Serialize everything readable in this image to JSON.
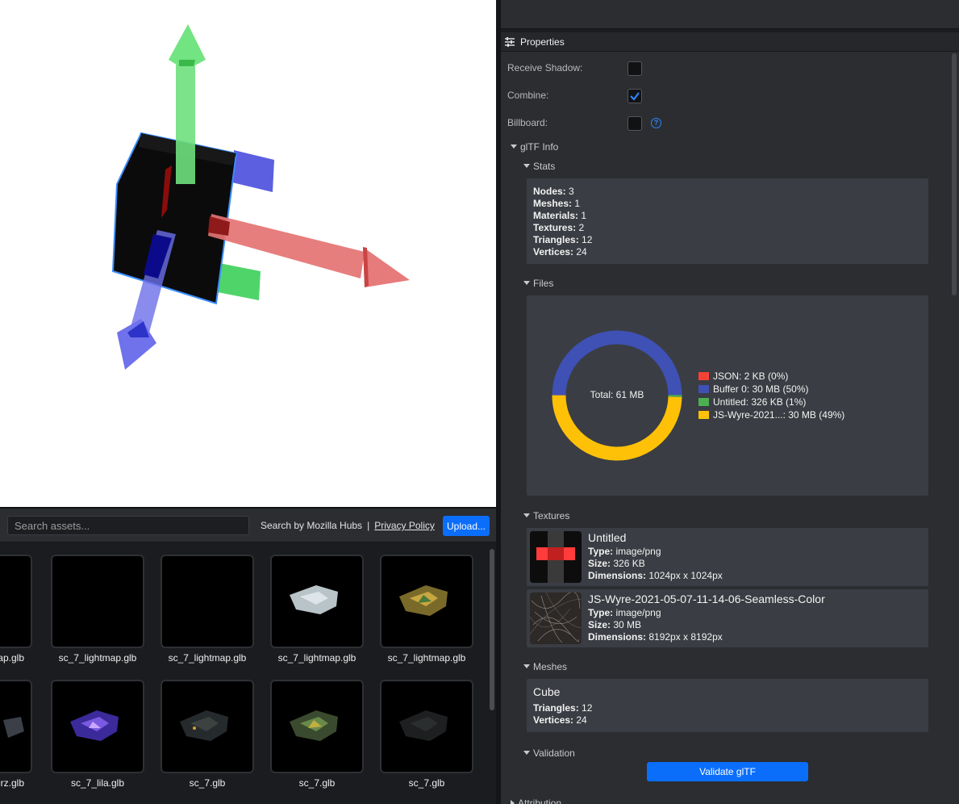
{
  "assets": {
    "search_placeholder": "Search assets...",
    "search_by_text": "Search by Mozilla Hubs",
    "separator": "|",
    "privacy_link": "Privacy Policy",
    "upload_label": "Upload...",
    "items": [
      {
        "label": "ap.glb"
      },
      {
        "label": "sc_7_lightmap.glb"
      },
      {
        "label": "sc_7_lightmap.glb"
      },
      {
        "label": "sc_7_lightmap.glb"
      },
      {
        "label": "sc_7_lightmap.glb"
      },
      {
        "label": "rz.glb"
      },
      {
        "label": "sc_7_lila.glb"
      },
      {
        "label": "sc_7.glb"
      },
      {
        "label": "sc_7.glb"
      },
      {
        "label": "sc_7.glb"
      }
    ]
  },
  "properties": {
    "title": "Properties",
    "receive_shadow_label": "Receive Shadow:",
    "receive_shadow_checked": false,
    "combine_label": "Combine:",
    "combine_checked": true,
    "billboard_label": "Billboard:",
    "billboard_checked": false,
    "help_glyph": "?",
    "gltf_info_label": "glTF Info",
    "stats_label": "Stats",
    "stats": [
      {
        "key": "Nodes:",
        "value": " 3"
      },
      {
        "key": "Meshes:",
        "value": " 1"
      },
      {
        "key": "Materials:",
        "value": " 1"
      },
      {
        "key": "Textures:",
        "value": " 2"
      },
      {
        "key": "Triangles:",
        "value": " 12"
      },
      {
        "key": "Vertices:",
        "value": " 24"
      }
    ],
    "files_label": "Files",
    "files_total": "Total: 61 MB",
    "files": [
      {
        "label": "JSON: 2 KB (0%)",
        "color": "#f44336",
        "fraction": 3e-05
      },
      {
        "label": "Buffer 0: 30 MB (50%)",
        "color": "#3f51b5",
        "fraction": 0.4977
      },
      {
        "label": "Untitled: 326 KB (1%)",
        "color": "#4caf50",
        "fraction": 0.0054
      },
      {
        "label": "JS-Wyre-2021...: 30 MB (49%)",
        "color": "#ffc107",
        "fraction": 0.4968
      }
    ],
    "textures_label": "Textures",
    "textures": [
      {
        "name": "Untitled",
        "type_key": "Type:",
        "type": " image/png",
        "size_key": "Size:",
        "size": " 326 KB",
        "dim_key": "Dimensions:",
        "dim": " 1024px x 1024px"
      },
      {
        "name": "JS-Wyre-2021-05-07-11-14-06-Seamless-Color",
        "type_key": "Type:",
        "type": " image/png",
        "size_key": "Size:",
        "size": " 30 MB",
        "dim_key": "Dimensions:",
        "dim": " 8192px x 8192px"
      }
    ],
    "meshes_label": "Meshes",
    "mesh": {
      "name": "Cube",
      "tri_key": "Triangles:",
      "tri": " 12",
      "vert_key": "Vertices:",
      "vert": " 24"
    },
    "validation_label": "Validation",
    "validate_button": "Validate glTF",
    "attribution_label": "Attribution"
  }
}
